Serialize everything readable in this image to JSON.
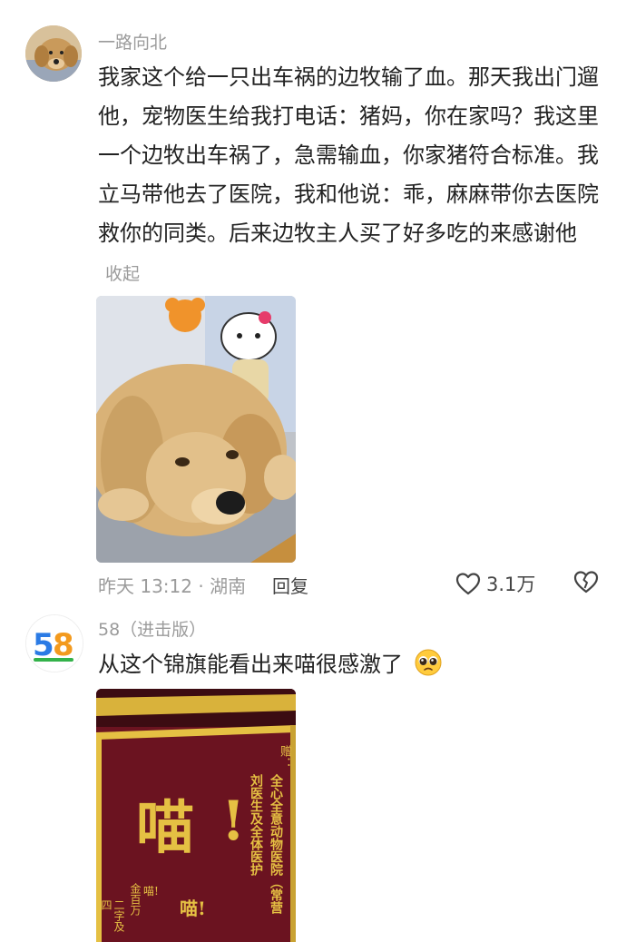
{
  "comments": [
    {
      "username": "一路向北",
      "text": "我家这个给一只出车祸的边牧输了血。那天我出门遛他，宠物医生给我打电话：猪妈，你在家吗？我这里一个边牧出车祸了，急需输血，你家猪符合标准。我立马带他去了医院，我和他说：乖，麻麻带你去医院救你的同类。后来边牧主人买了好多吃的来感谢他",
      "collapse_label": "收起",
      "time_location": "昨天 13:12 · 湖南",
      "reply_label": "回复",
      "like_count": "3.1万",
      "avatar_icon": "golden-retriever-avatar",
      "photo_icon": "golden-retriever-photo"
    },
    {
      "username": "58（进击版）",
      "avatar_text": "58",
      "text": "从这个锦旗能看出来喵很感激了",
      "emoji": "pleading-face-emoji",
      "banner": {
        "big_char": "喵",
        "exclaim": "!",
        "small_text": "喵!",
        "donor_label": "赠：",
        "col1": "全心全意动物医院（常营",
        "col2": "刘医生及全体医护",
        "left_col1": "金百万",
        "left_col2": "二字及四",
        "small_meow": "喵!"
      }
    }
  ],
  "colors": {
    "username": "#9b9b9b",
    "banner_red": "#6b1320",
    "banner_gold": "#e5c043",
    "logo_blue": "#2b7be5",
    "logo_orange": "#f39a1e",
    "logo_green": "#33b24a"
  }
}
